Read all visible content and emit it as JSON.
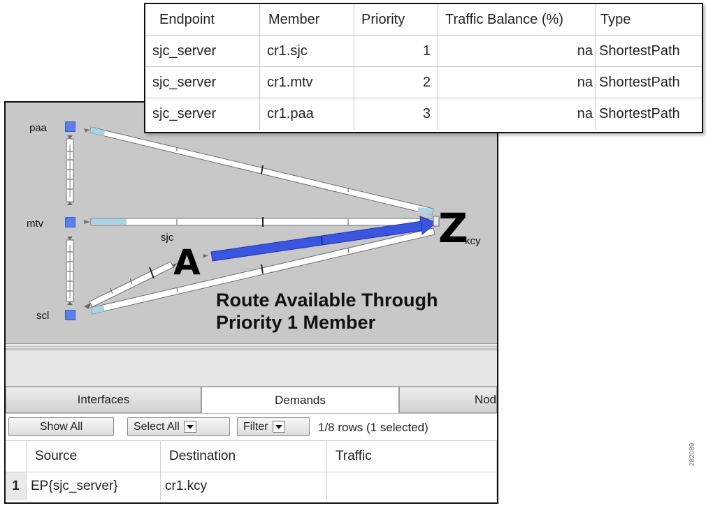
{
  "map": {
    "nodes": [
      {
        "id": "paa",
        "label": "paa"
      },
      {
        "id": "mtv",
        "label": "mtv"
      },
      {
        "id": "scl",
        "label": "scl"
      }
    ],
    "sjc_label": "sjc",
    "kcy_label": "kcy",
    "letter_a": "A",
    "letter_z": "Z",
    "caption_line1": "Route Available  Through",
    "caption_line2": "Priority 1 Member",
    "colors": {
      "map_bg": "#c8c8c8",
      "node": "#5b7fe8",
      "demand_path": "#3a56e0",
      "link_fill": "#ffffff",
      "link_accent": "#a8d4e6"
    }
  },
  "tabs": [
    {
      "label": "Interfaces",
      "active": false
    },
    {
      "label": "Demands",
      "active": true
    },
    {
      "label": "Nod",
      "active": false
    }
  ],
  "toolbar": {
    "show_all": "Show All",
    "select_all": "Select All",
    "filter": "Filter",
    "rows_status": "1/8 rows (1 selected)"
  },
  "grid": {
    "columns": [
      "Source",
      "Destination",
      "Traffic"
    ],
    "rows": [
      {
        "num": "1",
        "source": "EP{sjc_server}",
        "destination": "cr1.kcy",
        "traffic": ""
      }
    ]
  },
  "endpoint_table": {
    "columns": [
      "Endpoint",
      "Member",
      "Priority",
      "Traffic Balance (%)",
      "Type"
    ],
    "rows": [
      {
        "endpoint": "sjc_server",
        "member": "cr1.sjc",
        "priority": "1",
        "balance": "na",
        "type": "ShortestPath"
      },
      {
        "endpoint": "sjc_server",
        "member": "cr1.mtv",
        "priority": "2",
        "balance": "na",
        "type": "ShortestPath"
      },
      {
        "endpoint": "sjc_server",
        "member": "cr1.paa",
        "priority": "3",
        "balance": "na",
        "type": "ShortestPath"
      }
    ]
  },
  "side_note": "282089"
}
